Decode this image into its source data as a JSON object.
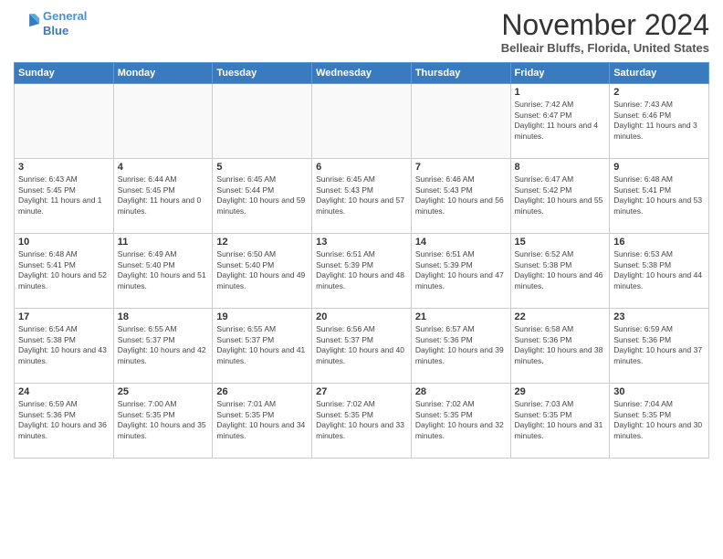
{
  "header": {
    "logo_line1": "General",
    "logo_line2": "Blue",
    "month": "November 2024",
    "location": "Belleair Bluffs, Florida, United States"
  },
  "days_of_week": [
    "Sunday",
    "Monday",
    "Tuesday",
    "Wednesday",
    "Thursday",
    "Friday",
    "Saturday"
  ],
  "weeks": [
    [
      {
        "day": "",
        "info": ""
      },
      {
        "day": "",
        "info": ""
      },
      {
        "day": "",
        "info": ""
      },
      {
        "day": "",
        "info": ""
      },
      {
        "day": "",
        "info": ""
      },
      {
        "day": "1",
        "info": "Sunrise: 7:42 AM\nSunset: 6:47 PM\nDaylight: 11 hours and 4 minutes."
      },
      {
        "day": "2",
        "info": "Sunrise: 7:43 AM\nSunset: 6:46 PM\nDaylight: 11 hours and 3 minutes."
      }
    ],
    [
      {
        "day": "3",
        "info": "Sunrise: 6:43 AM\nSunset: 5:45 PM\nDaylight: 11 hours and 1 minute."
      },
      {
        "day": "4",
        "info": "Sunrise: 6:44 AM\nSunset: 5:45 PM\nDaylight: 11 hours and 0 minutes."
      },
      {
        "day": "5",
        "info": "Sunrise: 6:45 AM\nSunset: 5:44 PM\nDaylight: 10 hours and 59 minutes."
      },
      {
        "day": "6",
        "info": "Sunrise: 6:45 AM\nSunset: 5:43 PM\nDaylight: 10 hours and 57 minutes."
      },
      {
        "day": "7",
        "info": "Sunrise: 6:46 AM\nSunset: 5:43 PM\nDaylight: 10 hours and 56 minutes."
      },
      {
        "day": "8",
        "info": "Sunrise: 6:47 AM\nSunset: 5:42 PM\nDaylight: 10 hours and 55 minutes."
      },
      {
        "day": "9",
        "info": "Sunrise: 6:48 AM\nSunset: 5:41 PM\nDaylight: 10 hours and 53 minutes."
      }
    ],
    [
      {
        "day": "10",
        "info": "Sunrise: 6:48 AM\nSunset: 5:41 PM\nDaylight: 10 hours and 52 minutes."
      },
      {
        "day": "11",
        "info": "Sunrise: 6:49 AM\nSunset: 5:40 PM\nDaylight: 10 hours and 51 minutes."
      },
      {
        "day": "12",
        "info": "Sunrise: 6:50 AM\nSunset: 5:40 PM\nDaylight: 10 hours and 49 minutes."
      },
      {
        "day": "13",
        "info": "Sunrise: 6:51 AM\nSunset: 5:39 PM\nDaylight: 10 hours and 48 minutes."
      },
      {
        "day": "14",
        "info": "Sunrise: 6:51 AM\nSunset: 5:39 PM\nDaylight: 10 hours and 47 minutes."
      },
      {
        "day": "15",
        "info": "Sunrise: 6:52 AM\nSunset: 5:38 PM\nDaylight: 10 hours and 46 minutes."
      },
      {
        "day": "16",
        "info": "Sunrise: 6:53 AM\nSunset: 5:38 PM\nDaylight: 10 hours and 44 minutes."
      }
    ],
    [
      {
        "day": "17",
        "info": "Sunrise: 6:54 AM\nSunset: 5:38 PM\nDaylight: 10 hours and 43 minutes."
      },
      {
        "day": "18",
        "info": "Sunrise: 6:55 AM\nSunset: 5:37 PM\nDaylight: 10 hours and 42 minutes."
      },
      {
        "day": "19",
        "info": "Sunrise: 6:55 AM\nSunset: 5:37 PM\nDaylight: 10 hours and 41 minutes."
      },
      {
        "day": "20",
        "info": "Sunrise: 6:56 AM\nSunset: 5:37 PM\nDaylight: 10 hours and 40 minutes."
      },
      {
        "day": "21",
        "info": "Sunrise: 6:57 AM\nSunset: 5:36 PM\nDaylight: 10 hours and 39 minutes."
      },
      {
        "day": "22",
        "info": "Sunrise: 6:58 AM\nSunset: 5:36 PM\nDaylight: 10 hours and 38 minutes."
      },
      {
        "day": "23",
        "info": "Sunrise: 6:59 AM\nSunset: 5:36 PM\nDaylight: 10 hours and 37 minutes."
      }
    ],
    [
      {
        "day": "24",
        "info": "Sunrise: 6:59 AM\nSunset: 5:36 PM\nDaylight: 10 hours and 36 minutes."
      },
      {
        "day": "25",
        "info": "Sunrise: 7:00 AM\nSunset: 5:35 PM\nDaylight: 10 hours and 35 minutes."
      },
      {
        "day": "26",
        "info": "Sunrise: 7:01 AM\nSunset: 5:35 PM\nDaylight: 10 hours and 34 minutes."
      },
      {
        "day": "27",
        "info": "Sunrise: 7:02 AM\nSunset: 5:35 PM\nDaylight: 10 hours and 33 minutes."
      },
      {
        "day": "28",
        "info": "Sunrise: 7:02 AM\nSunset: 5:35 PM\nDaylight: 10 hours and 32 minutes."
      },
      {
        "day": "29",
        "info": "Sunrise: 7:03 AM\nSunset: 5:35 PM\nDaylight: 10 hours and 31 minutes."
      },
      {
        "day": "30",
        "info": "Sunrise: 7:04 AM\nSunset: 5:35 PM\nDaylight: 10 hours and 30 minutes."
      }
    ]
  ]
}
